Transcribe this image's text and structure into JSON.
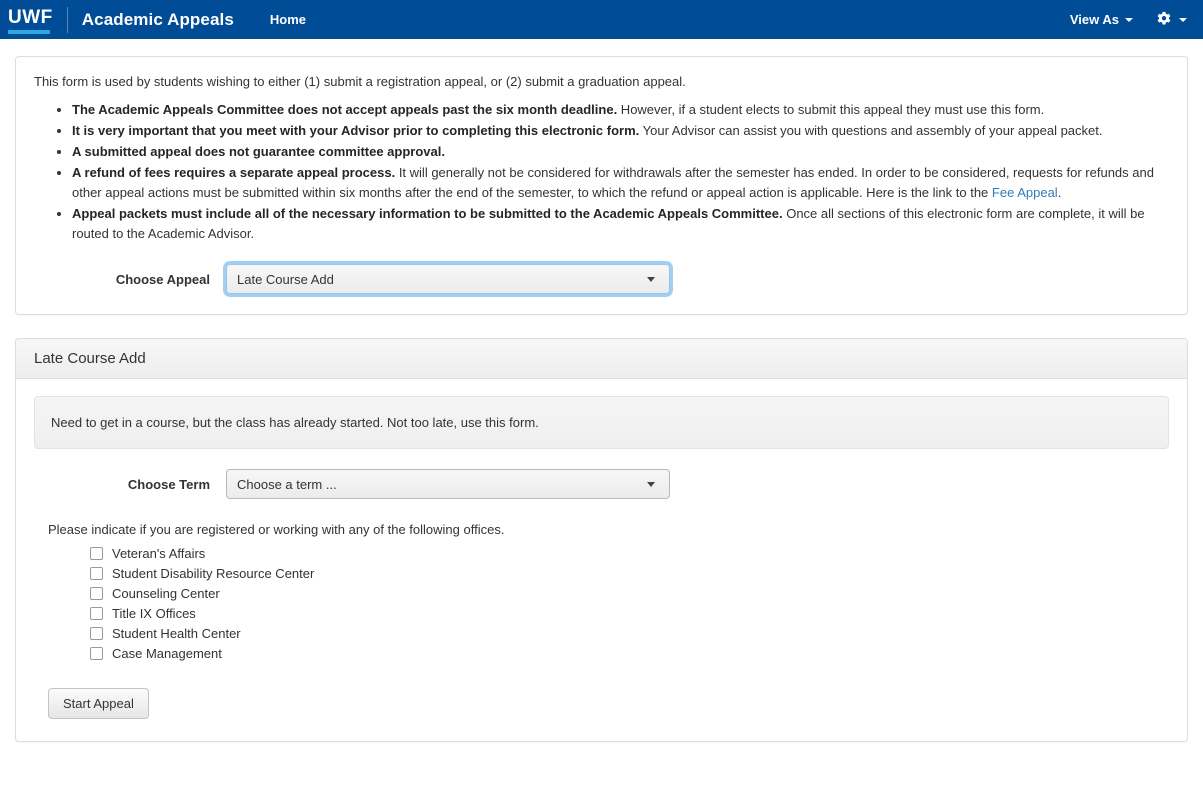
{
  "navbar": {
    "logo": "UWF",
    "brand": "Academic Appeals",
    "home_label": "Home",
    "view_as_label": "View As",
    "gear_icon": "gear-icon",
    "brand_color": "#004C97",
    "logo_underline_color": "#2BA8E0"
  },
  "intro": {
    "paragraph": "This form is used by students wishing to either (1) submit a registration appeal, or (2) submit a graduation appeal.",
    "notes": [
      {
        "bold": "The Academic Appeals Committee does not accept appeals past the six month deadline.",
        "rest": " However, if a student elects to submit this appeal they must use this form."
      },
      {
        "bold": "It is very important that you meet with your Advisor prior to completing this electronic form.",
        "rest": " Your Advisor can assist you with questions and assembly of your appeal packet."
      },
      {
        "bold": "A submitted appeal does not guarantee committee approval.",
        "rest": ""
      },
      {
        "bold": "A refund of fees requires a separate appeal process.",
        "rest": " It will generally not be considered for withdrawals after the semester has ended. In order to be considered, requests for refunds and other appeal actions must be submitted within six months after the end of the semester, to which the refund or appeal action is applicable. Here is the link to the ",
        "link_text": "Fee Appeal",
        "after_link": "."
      },
      {
        "bold": "Appeal packets must include all of the necessary information to be submitted to the Academic Appeals Committee.",
        "rest": " Once all sections of this electronic form are complete, it will be routed to the Academic Advisor."
      }
    ],
    "choose_appeal_label": "Choose Appeal",
    "choose_appeal_value": "Late Course Add"
  },
  "section": {
    "heading": "Late Course Add",
    "alert_text": "Need to get in a course, but the class has already started. Not too late, use this form.",
    "choose_term_label": "Choose Term",
    "choose_term_value": "Choose a term ...",
    "offices_prompt": "Please indicate if you are registered or working with any of the following offices.",
    "offices": [
      "Veteran's Affairs",
      "Student Disability Resource Center",
      "Counseling Center",
      "Title IX Offices",
      "Student Health Center",
      "Case Management"
    ],
    "start_button": "Start Appeal"
  }
}
